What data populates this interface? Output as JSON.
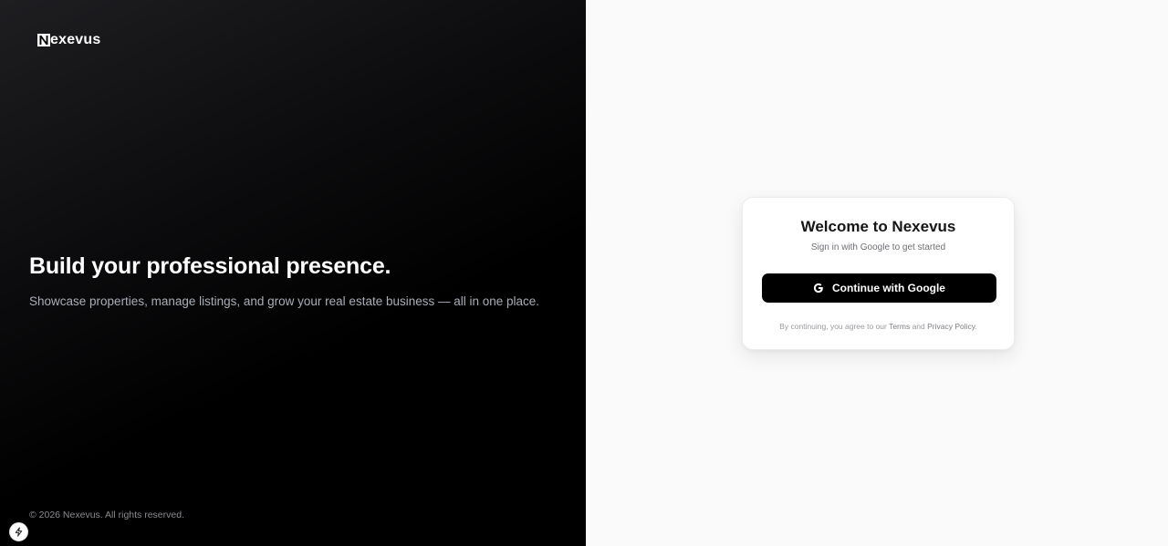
{
  "brand": {
    "name": "exevus",
    "mark_letter": "N"
  },
  "hero": {
    "title": "Build your professional presence.",
    "subtitle": "Showcase properties, manage listings, and grow your real estate business — all in one place."
  },
  "footer": {
    "copyright": "© 2026 Nexevus. All rights reserved."
  },
  "signin": {
    "title": "Welcome to Nexevus",
    "subtitle": "Sign in with Google to get started",
    "google_button": "Continue with Google",
    "legal_prefix": "By continuing, you agree to our ",
    "terms_link": "Terms",
    "legal_and": " and ",
    "privacy_link": "Privacy Policy",
    "legal_suffix": "."
  },
  "icons": {
    "logo": "nexevus-logo-icon",
    "google": "google-icon",
    "dev_tools": "lightning-icon"
  },
  "colors": {
    "left_panel": "#000000",
    "right_panel": "#fafafa",
    "button": "#000000",
    "button_text": "#ffffff"
  }
}
